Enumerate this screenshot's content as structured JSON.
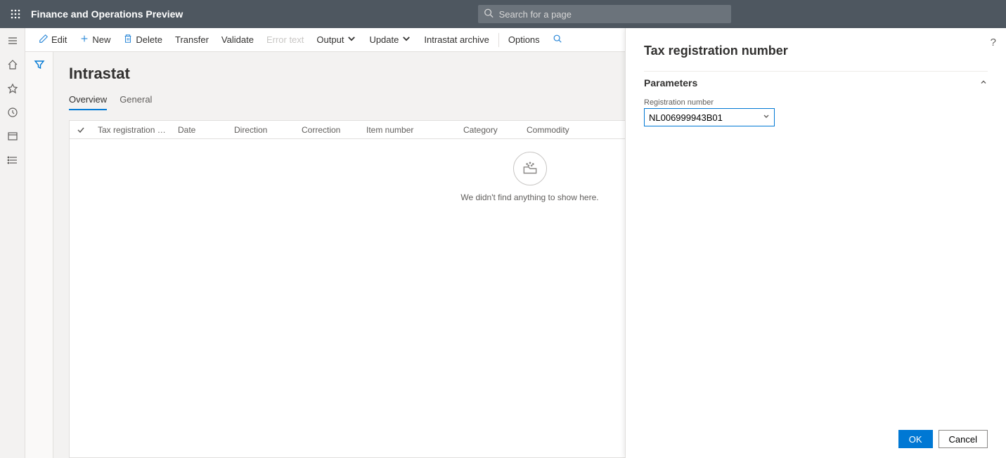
{
  "header": {
    "title": "Finance and Operations Preview",
    "search_placeholder": "Search for a page"
  },
  "actionbar": {
    "edit": "Edit",
    "new": "New",
    "delete": "Delete",
    "transfer": "Transfer",
    "validate": "Validate",
    "error_text": "Error text",
    "output": "Output",
    "update": "Update",
    "intrastat_archive": "Intrastat archive",
    "options": "Options"
  },
  "page": {
    "title": "Intrastat",
    "tabs": {
      "overview": "Overview",
      "general": "General"
    }
  },
  "grid": {
    "columns": {
      "tax_reg": "Tax registration num...",
      "date": "Date",
      "direction": "Direction",
      "correction": "Correction",
      "item_number": "Item number",
      "category": "Category",
      "commodity": "Commodity"
    },
    "empty_text": "We didn't find anything to show here."
  },
  "panel": {
    "title": "Tax registration number",
    "section": "Parameters",
    "field_label": "Registration number",
    "field_value": "NL006999943B01",
    "ok": "OK",
    "cancel": "Cancel"
  }
}
